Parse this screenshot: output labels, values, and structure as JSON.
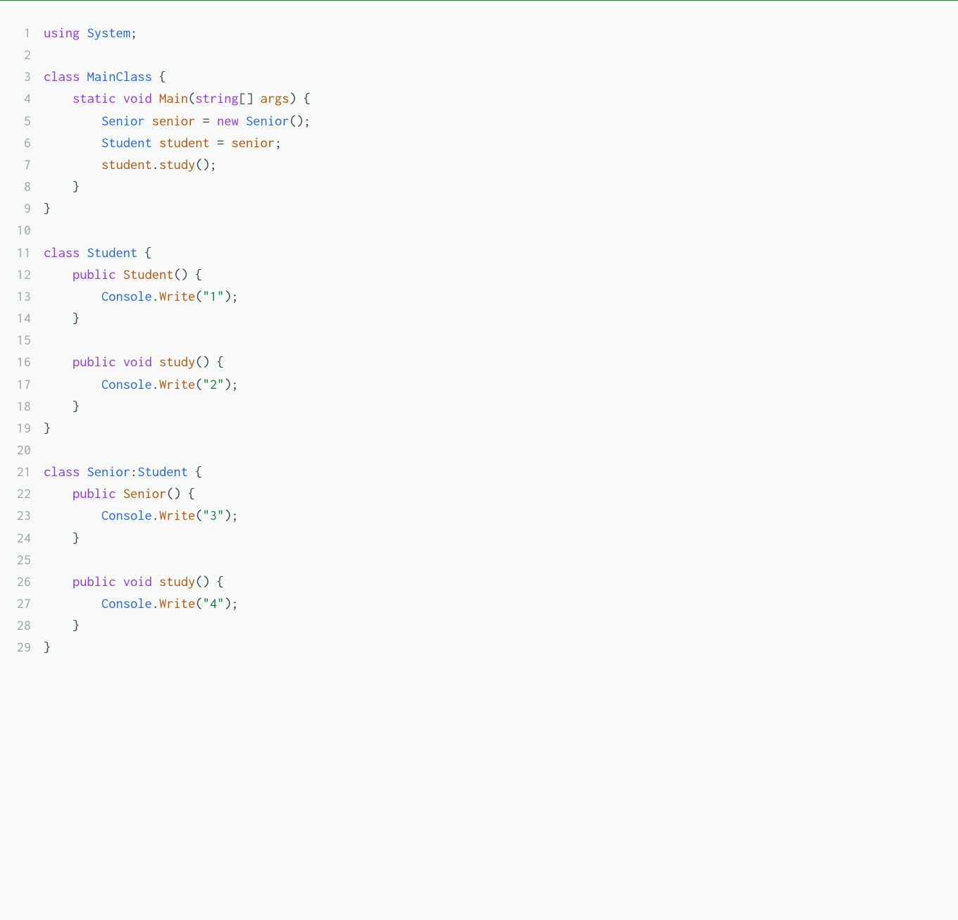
{
  "code": {
    "language": "csharp",
    "lines": [
      {
        "num": "1",
        "tokens": [
          {
            "t": "using ",
            "c": "tok-keyword"
          },
          {
            "t": "System",
            "c": "tok-type"
          },
          {
            "t": ";",
            "c": "tok-punct"
          }
        ]
      },
      {
        "num": "2",
        "tokens": []
      },
      {
        "num": "3",
        "tokens": [
          {
            "t": "class ",
            "c": "tok-keyword"
          },
          {
            "t": "MainClass",
            "c": "tok-type"
          },
          {
            "t": " {",
            "c": "tok-brace"
          }
        ]
      },
      {
        "num": "4",
        "tokens": [
          {
            "t": "    ",
            "c": "tok-default"
          },
          {
            "t": "static ",
            "c": "tok-keyword"
          },
          {
            "t": "void ",
            "c": "tok-keyword"
          },
          {
            "t": "Main",
            "c": "tok-func"
          },
          {
            "t": "(",
            "c": "tok-punct"
          },
          {
            "t": "string",
            "c": "tok-keyword"
          },
          {
            "t": "[] ",
            "c": "tok-punct"
          },
          {
            "t": "args",
            "c": "tok-var"
          },
          {
            "t": ") {",
            "c": "tok-brace"
          }
        ]
      },
      {
        "num": "5",
        "tokens": [
          {
            "t": "        ",
            "c": "tok-default"
          },
          {
            "t": "Senior",
            "c": "tok-type"
          },
          {
            "t": " ",
            "c": "tok-default"
          },
          {
            "t": "senior",
            "c": "tok-var"
          },
          {
            "t": " = ",
            "c": "tok-punct"
          },
          {
            "t": "new ",
            "c": "tok-keyword"
          },
          {
            "t": "Senior",
            "c": "tok-type"
          },
          {
            "t": "();",
            "c": "tok-punct"
          }
        ]
      },
      {
        "num": "6",
        "tokens": [
          {
            "t": "        ",
            "c": "tok-default"
          },
          {
            "t": "Student",
            "c": "tok-type"
          },
          {
            "t": " ",
            "c": "tok-default"
          },
          {
            "t": "student",
            "c": "tok-var"
          },
          {
            "t": " = ",
            "c": "tok-punct"
          },
          {
            "t": "senior",
            "c": "tok-var"
          },
          {
            "t": ";",
            "c": "tok-punct"
          }
        ]
      },
      {
        "num": "7",
        "tokens": [
          {
            "t": "        ",
            "c": "tok-default"
          },
          {
            "t": "student",
            "c": "tok-var"
          },
          {
            "t": ".",
            "c": "tok-punct"
          },
          {
            "t": "study",
            "c": "tok-method"
          },
          {
            "t": "();",
            "c": "tok-punct"
          }
        ]
      },
      {
        "num": "8",
        "tokens": [
          {
            "t": "    }",
            "c": "tok-brace"
          }
        ]
      },
      {
        "num": "9",
        "tokens": [
          {
            "t": "}",
            "c": "tok-brace"
          }
        ]
      },
      {
        "num": "10",
        "tokens": []
      },
      {
        "num": "11",
        "tokens": [
          {
            "t": "class ",
            "c": "tok-keyword"
          },
          {
            "t": "Student",
            "c": "tok-type"
          },
          {
            "t": " {",
            "c": "tok-brace"
          }
        ]
      },
      {
        "num": "12",
        "tokens": [
          {
            "t": "    ",
            "c": "tok-default"
          },
          {
            "t": "public ",
            "c": "tok-keyword"
          },
          {
            "t": "Student",
            "c": "tok-func"
          },
          {
            "t": "() {",
            "c": "tok-brace"
          }
        ]
      },
      {
        "num": "13",
        "tokens": [
          {
            "t": "        ",
            "c": "tok-default"
          },
          {
            "t": "Console",
            "c": "tok-type"
          },
          {
            "t": ".",
            "c": "tok-punct"
          },
          {
            "t": "Write",
            "c": "tok-method"
          },
          {
            "t": "(",
            "c": "tok-punct"
          },
          {
            "t": "\"1\"",
            "c": "tok-string"
          },
          {
            "t": ");",
            "c": "tok-punct"
          }
        ]
      },
      {
        "num": "14",
        "tokens": [
          {
            "t": "    }",
            "c": "tok-brace"
          }
        ]
      },
      {
        "num": "15",
        "tokens": []
      },
      {
        "num": "16",
        "tokens": [
          {
            "t": "    ",
            "c": "tok-default"
          },
          {
            "t": "public ",
            "c": "tok-keyword"
          },
          {
            "t": "void ",
            "c": "tok-keyword"
          },
          {
            "t": "study",
            "c": "tok-func"
          },
          {
            "t": "() {",
            "c": "tok-brace"
          }
        ]
      },
      {
        "num": "17",
        "tokens": [
          {
            "t": "        ",
            "c": "tok-default"
          },
          {
            "t": "Console",
            "c": "tok-type"
          },
          {
            "t": ".",
            "c": "tok-punct"
          },
          {
            "t": "Write",
            "c": "tok-method"
          },
          {
            "t": "(",
            "c": "tok-punct"
          },
          {
            "t": "\"2\"",
            "c": "tok-string"
          },
          {
            "t": ");",
            "c": "tok-punct"
          }
        ]
      },
      {
        "num": "18",
        "tokens": [
          {
            "t": "    }",
            "c": "tok-brace"
          }
        ]
      },
      {
        "num": "19",
        "tokens": [
          {
            "t": "}",
            "c": "tok-brace"
          }
        ]
      },
      {
        "num": "20",
        "tokens": []
      },
      {
        "num": "21",
        "tokens": [
          {
            "t": "class ",
            "c": "tok-keyword"
          },
          {
            "t": "Senior",
            "c": "tok-type"
          },
          {
            "t": ":",
            "c": "tok-punct"
          },
          {
            "t": "Student",
            "c": "tok-type"
          },
          {
            "t": " {",
            "c": "tok-brace"
          }
        ]
      },
      {
        "num": "22",
        "tokens": [
          {
            "t": "    ",
            "c": "tok-default"
          },
          {
            "t": "public ",
            "c": "tok-keyword"
          },
          {
            "t": "Senior",
            "c": "tok-func"
          },
          {
            "t": "() {",
            "c": "tok-brace"
          }
        ]
      },
      {
        "num": "23",
        "tokens": [
          {
            "t": "        ",
            "c": "tok-default"
          },
          {
            "t": "Console",
            "c": "tok-type"
          },
          {
            "t": ".",
            "c": "tok-punct"
          },
          {
            "t": "Write",
            "c": "tok-method"
          },
          {
            "t": "(",
            "c": "tok-punct"
          },
          {
            "t": "\"3\"",
            "c": "tok-string"
          },
          {
            "t": ");",
            "c": "tok-punct"
          }
        ]
      },
      {
        "num": "24",
        "tokens": [
          {
            "t": "    }",
            "c": "tok-brace"
          }
        ]
      },
      {
        "num": "25",
        "tokens": []
      },
      {
        "num": "26",
        "tokens": [
          {
            "t": "    ",
            "c": "tok-default"
          },
          {
            "t": "public ",
            "c": "tok-keyword"
          },
          {
            "t": "void ",
            "c": "tok-keyword"
          },
          {
            "t": "study",
            "c": "tok-func"
          },
          {
            "t": "() {",
            "c": "tok-brace"
          }
        ]
      },
      {
        "num": "27",
        "tokens": [
          {
            "t": "        ",
            "c": "tok-default"
          },
          {
            "t": "Console",
            "c": "tok-type"
          },
          {
            "t": ".",
            "c": "tok-punct"
          },
          {
            "t": "Write",
            "c": "tok-method"
          },
          {
            "t": "(",
            "c": "tok-punct"
          },
          {
            "t": "\"4\"",
            "c": "tok-string"
          },
          {
            "t": ");",
            "c": "tok-punct"
          }
        ]
      },
      {
        "num": "28",
        "tokens": [
          {
            "t": "    }",
            "c": "tok-brace"
          }
        ]
      },
      {
        "num": "29",
        "tokens": [
          {
            "t": "}",
            "c": "tok-brace"
          }
        ]
      }
    ]
  }
}
